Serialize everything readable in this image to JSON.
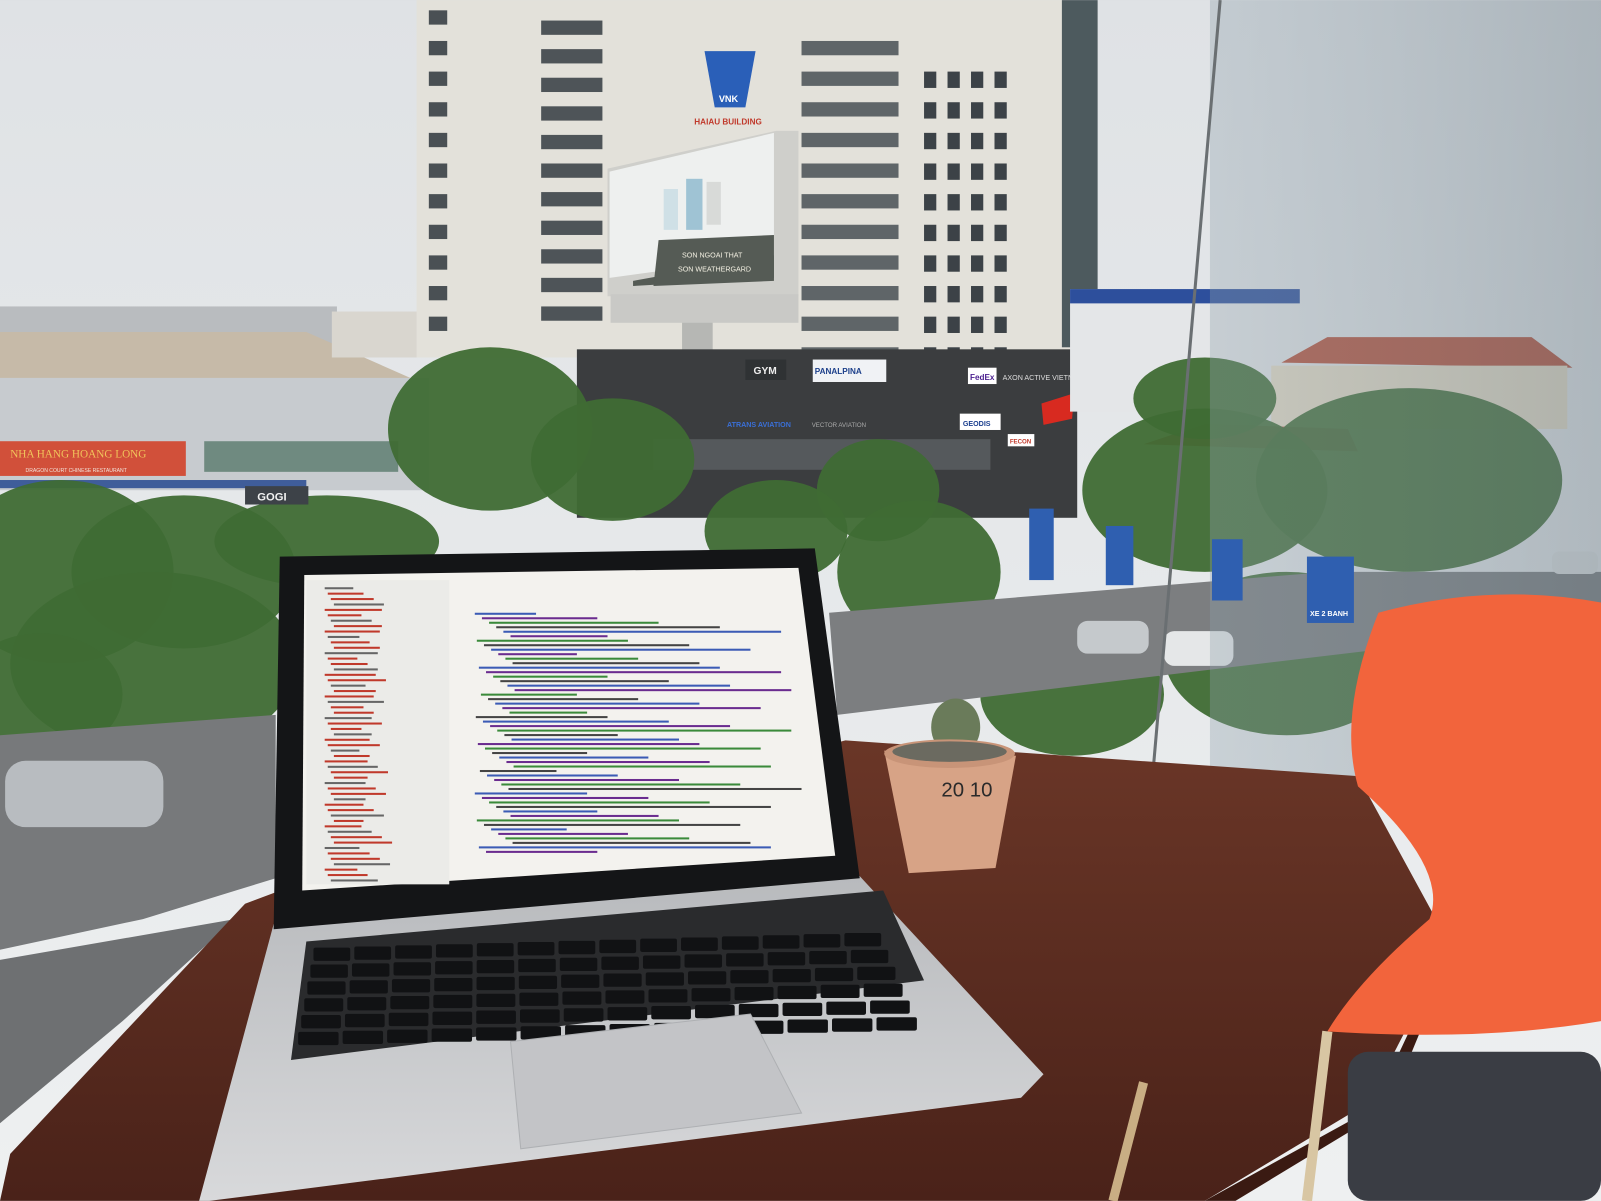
{
  "scene": {
    "restaurant_sign": "NHA HANG HOANG LONG",
    "restaurant_subtitle": "DRAGON COURT CHINESE RESTAURANT",
    "gogi_sign": "GOGI",
    "building_logo": "VNK",
    "building_name": "HAIAU BUILDING",
    "billboard_line1": "SON NGOAI THAT",
    "billboard_line2": "SON WEATHERGARD",
    "storefront_signs": [
      "GYM",
      "PANALPINA",
      "FedEx",
      "AXON ACTIVE VIETNAM",
      "ATRANS AVIATION",
      "VECTOR AVIATION",
      "GEODIS",
      "FECON"
    ],
    "road_sign": "XE 2 BANH",
    "pot_label": "20 10"
  },
  "colors": {
    "sky": "#e6e8ea",
    "table": "#5c2e22",
    "chair": "#f2643c",
    "laptop": "#c8c9cc",
    "trees": "#3f6b34"
  }
}
